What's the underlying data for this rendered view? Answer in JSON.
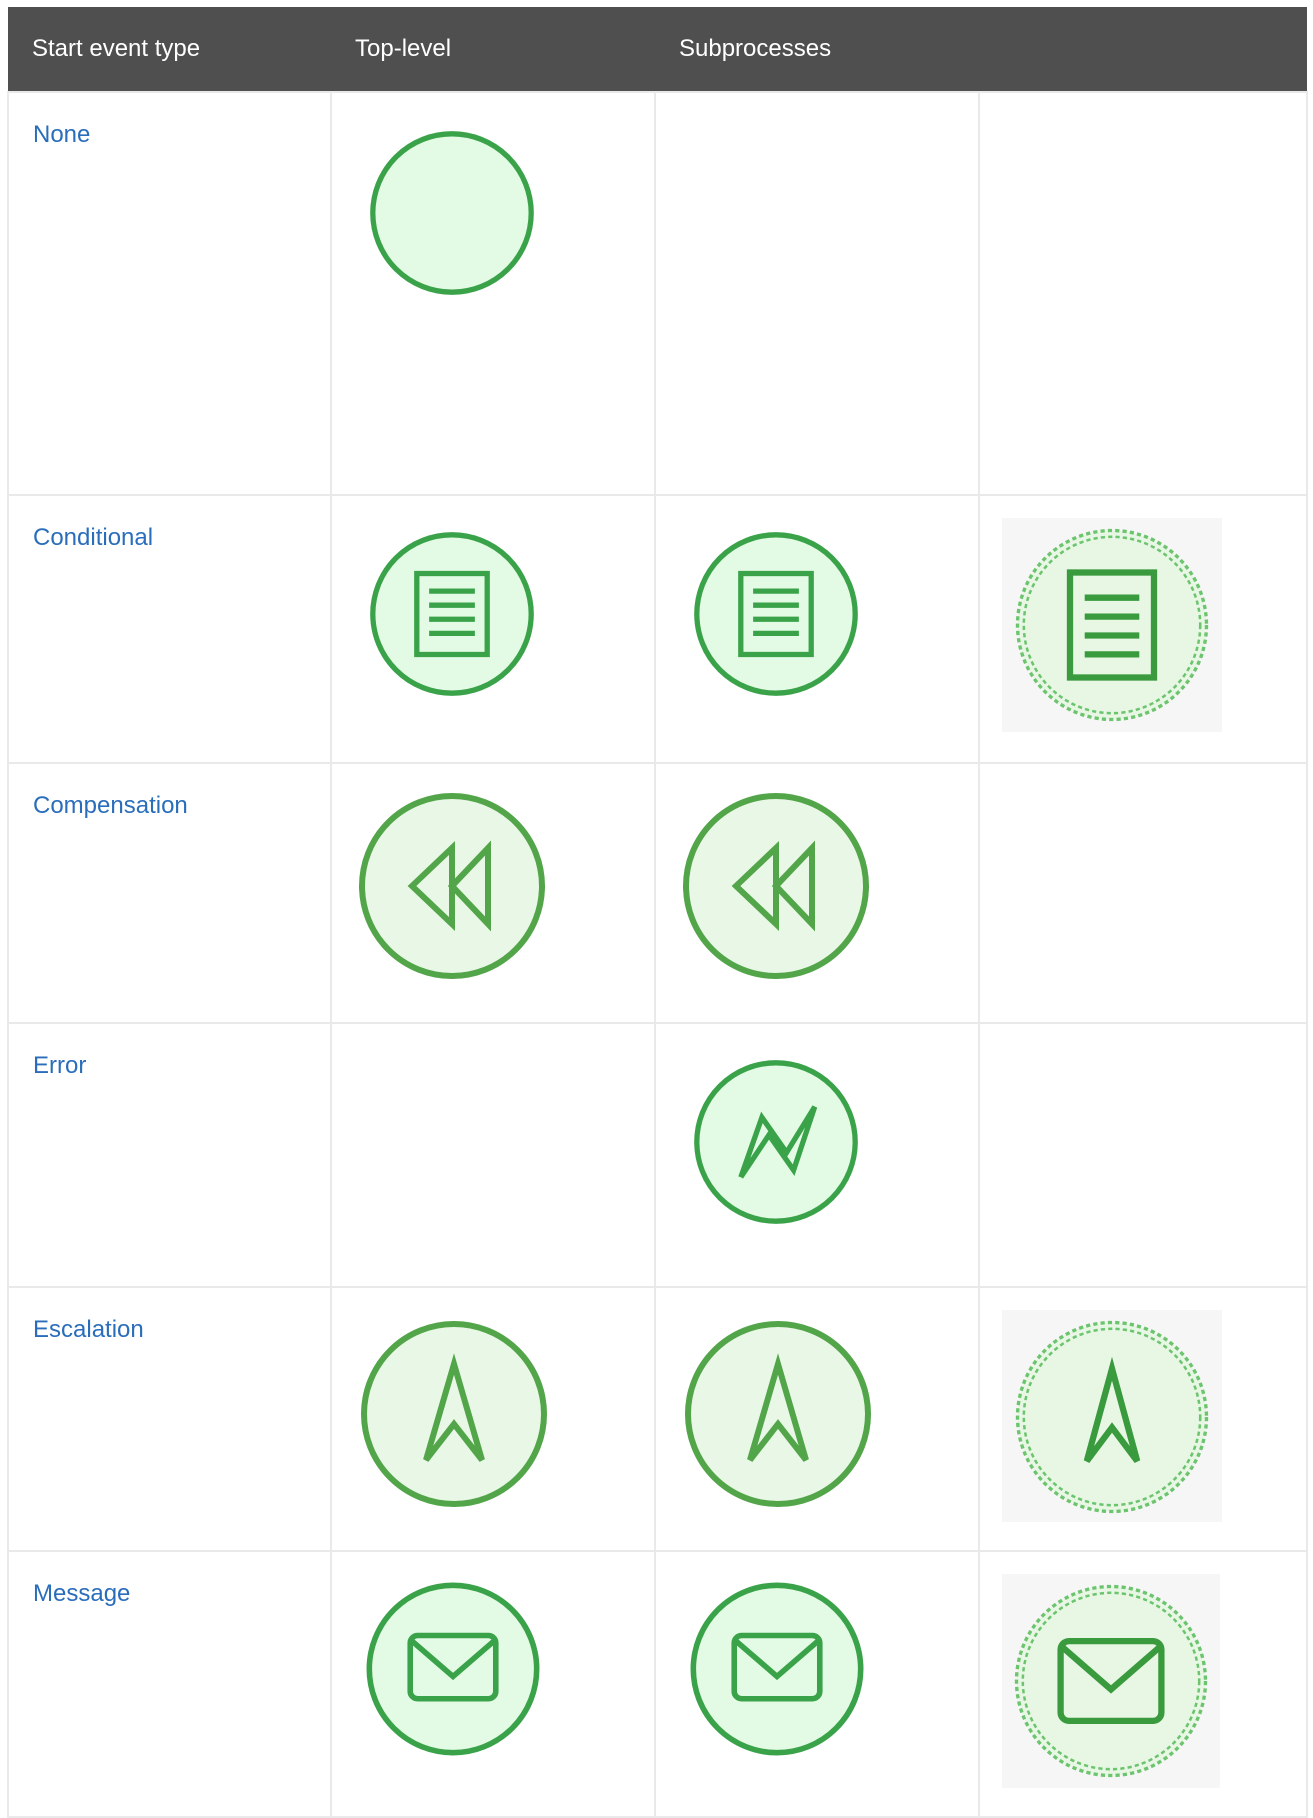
{
  "table": {
    "headers": [
      "Start event type",
      "Top-level",
      "Subprocesses",
      ""
    ],
    "rows": [
      {
        "name": "None",
        "top_level": "none",
        "subprocess": "",
        "subprocess_non_interrupting": ""
      },
      {
        "name": "Conditional",
        "top_level": "conditional",
        "subprocess": "conditional",
        "subprocess_non_interrupting": "conditional"
      },
      {
        "name": "Compensation",
        "top_level": "compensation",
        "subprocess": "compensation",
        "subprocess_non_interrupting": ""
      },
      {
        "name": "Error",
        "top_level": "",
        "subprocess": "error",
        "subprocess_non_interrupting": ""
      },
      {
        "name": "Escalation",
        "top_level": "escalation",
        "subprocess": "escalation",
        "subprocess_non_interrupting": "escalation"
      },
      {
        "name": "Message",
        "top_level": "message",
        "subprocess": "message",
        "subprocess_non_interrupting": "message"
      }
    ]
  },
  "colors": {
    "header_bg": "#4f4f4f",
    "header_text": "#ffffff",
    "link": "#2a6ebb",
    "event_stroke": "#3aa34a",
    "event_fill": "#e3fbe4",
    "grid": "#e9e9e9"
  }
}
